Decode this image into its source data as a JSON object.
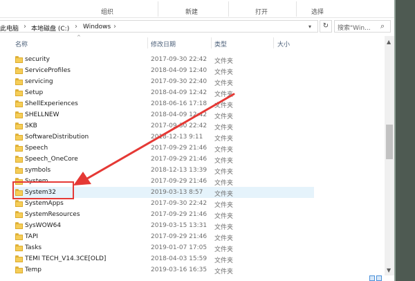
{
  "ribbon": {
    "groups": [
      "组织",
      "新建",
      "打开",
      "选择"
    ]
  },
  "address": {
    "crumbs": [
      "此电脑",
      "本地磁盘 (C:)",
      "Windows"
    ],
    "separator": "›",
    "search_placeholder": "搜索\"Win..."
  },
  "columns": {
    "name": "名称",
    "date": "修改日期",
    "type": "类型",
    "size": "大小"
  },
  "files": [
    {
      "name": "security",
      "date": "2017-09-30 22:42",
      "type": "文件夹"
    },
    {
      "name": "ServiceProfiles",
      "date": "2018-04-09 12:40",
      "type": "文件夹"
    },
    {
      "name": "servicing",
      "date": "2017-09-30 22:40",
      "type": "文件夹"
    },
    {
      "name": "Setup",
      "date": "2018-04-09 12:42",
      "type": "文件夹"
    },
    {
      "name": "ShellExperiences",
      "date": "2018-06-16 17:18",
      "type": "文件夹"
    },
    {
      "name": "SHELLNEW",
      "date": "2018-04-09 12:42",
      "type": "文件夹"
    },
    {
      "name": "SKB",
      "date": "2017-09-30 22:42",
      "type": "文件夹"
    },
    {
      "name": "SoftwareDistribution",
      "date": "2018-12-13 9:11",
      "type": "文件夹"
    },
    {
      "name": "Speech",
      "date": "2017-09-29 21:46",
      "type": "文件夹"
    },
    {
      "name": "Speech_OneCore",
      "date": "2017-09-29 21:46",
      "type": "文件夹"
    },
    {
      "name": "symbols",
      "date": "2018-12-13 13:39",
      "type": "文件夹"
    },
    {
      "name": "System",
      "date": "2017-09-29 21:46",
      "type": "文件夹"
    },
    {
      "name": "System32",
      "date": "2019-03-13 8:57",
      "type": "文件夹"
    },
    {
      "name": "SystemApps",
      "date": "2017-09-30 22:42",
      "type": "文件夹"
    },
    {
      "name": "SystemResources",
      "date": "2017-09-29 21:46",
      "type": "文件夹"
    },
    {
      "name": "SysWOW64",
      "date": "2019-03-15 13:31",
      "type": "文件夹"
    },
    {
      "name": "TAPI",
      "date": "2017-09-29 21:46",
      "type": "文件夹"
    },
    {
      "name": "Tasks",
      "date": "2019-01-07 17:05",
      "type": "文件夹"
    },
    {
      "name": "TEMI TECH_V14.3CE[OLD]",
      "date": "2018-04-03 15:59",
      "type": "文件夹"
    },
    {
      "name": "Temp",
      "date": "2019-03-16 16:35",
      "type": "文件夹"
    }
  ],
  "selected_index": 12,
  "icons": {
    "folder": "folder-icon",
    "refresh": "refresh-icon",
    "search": "search-icon",
    "dropdown": "chevron-down-icon",
    "scroll_up": "scroll-up-icon",
    "scroll_down": "scroll-down-icon"
  },
  "colors": {
    "annotation": "#e53935",
    "selection": "#e5f3fb",
    "header_text": "#4c607a"
  }
}
